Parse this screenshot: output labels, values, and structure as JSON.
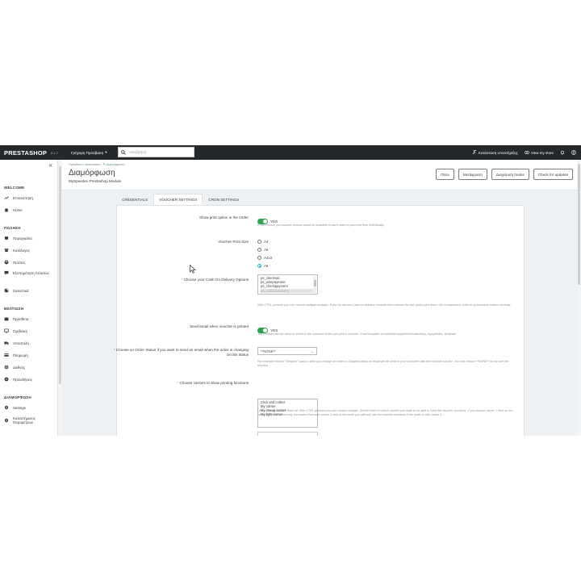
{
  "topbar": {
    "logo": "PRESTASHOP",
    "version": "8.1.7",
    "quick_access": "Γρήγορη Πρόσβαση",
    "search_placeholder": "Αναζήτηση",
    "maintenance": "Κατάσταση υποστήριξης",
    "view_store": "View my store"
  },
  "sidebar": {
    "sections": [
      {
        "title": "WELCOME",
        "items": [
          {
            "label": "Επισκόπηση",
            "icon": "trend-icon"
          },
          {
            "label": "Home",
            "icon": "home-icon"
          }
        ]
      },
      {
        "title": "ΠΩΛΗΣΗ",
        "items": [
          {
            "label": "Παραγγελίες",
            "icon": "cart-icon"
          },
          {
            "label": "Κατάλογος",
            "icon": "store-icon"
          },
          {
            "label": "Πελάτες",
            "icon": "user-icon"
          },
          {
            "label": "Εξυπηρέτηση πελατών",
            "icon": "chat-icon"
          },
          {
            "label": "Στατιστικά",
            "icon": "chart-icon"
          }
        ]
      },
      {
        "title": "ΒΕΛΤΙΩΣΗ",
        "items": [
          {
            "label": "Πρόσθετα",
            "icon": "puzzle-icon"
          },
          {
            "label": "Σχεδίαση",
            "icon": "desktop-icon"
          },
          {
            "label": "Αποστολή",
            "icon": "truck-icon"
          },
          {
            "label": "Πληρωμή",
            "icon": "card-icon"
          },
          {
            "label": "Διεθνής",
            "icon": "globe-icon"
          },
          {
            "label": "Προωθήσεις",
            "icon": "tag-icon"
          }
        ]
      },
      {
        "title": "ΔΙΑΜΟΡΦΩΣΗ",
        "items": [
          {
            "label": "Settings",
            "icon": "gear-icon"
          },
          {
            "label": "Καταστήματος Παραμέτρων",
            "icon": "gear-icon"
          }
        ]
      }
    ]
  },
  "header": {
    "breadcrumb": [
      "Πρόσθετα",
      "mymodules",
      "Διαμόρφωση"
    ],
    "title": "Διαμόρφωση",
    "subtitle": "MySpeedex Prestashop Module",
    "buttons": [
      "Πίσω",
      "Μετάφραση",
      "Διαχείριση hooks",
      "Check for updates"
    ]
  },
  "tabs": [
    "CREDENTIALS",
    "VOUCHER SETTINGS",
    "CRON SETTINGS"
  ],
  "active_tab": "VOUCHER SETTINGS",
  "form": {
    "show_print": {
      "label": "Show print option in the Order",
      "value": "YES",
      "help": "If you choose yes voucher actions would be available in each order to print one from individually."
    },
    "voucher_size": {
      "label": "Voucher Print Size",
      "options": [
        "A4",
        "A6",
        "A4x3",
        "A6"
      ],
      "selected": 3
    },
    "cod": {
      "label": "Choose your Cash On Delivery Options",
      "options": [
        "ps_checkout",
        "ps_wirepayment",
        "ps_checkpayment",
        "ps_cashondelivery"
      ],
      "help": "With CTRL pressed you can choose multiple modules. If you do not use Cash on delivery modules then choose the last option pick there, this is required in order to synchronize orders correctly."
    },
    "send_email": {
      "label": "Send email when voucher is printed",
      "value": "YES",
      "help": "The module will can send an email to the customer when you print a voucher. Email template at modules/myspeedex/mails/el/ps_myspeedex_template"
    },
    "order_status": {
      "label": "Choose an Order Status if you want to send an email when the order is changing on this status",
      "value": "**NONE**",
      "help": "For example choose \"Shipped\" status, when you change an order to Shipped status an email will be send to your customer with the voucher number. You can choose **NONE** to not use this function."
    },
    "carriers": {
      "label": "Choose carriers to show printing functions",
      "options": [
        "Click and collect",
        "My carrier",
        "My cheap carrier",
        "My light carrier"
      ],
      "help": "Leave it blank to have them all. With CTRL pressed you can choose multiple. Decide which in which carriers you want to be able to have the voucher functions. If you choose carrier 1 then on the orders list you will see only the orders that have carrier 1 sent to the order you will only see the voucher functions if the order is with carrier 1."
    }
  },
  "colors": {
    "topbar": "#25282b",
    "toggle": "#2ea44f",
    "accent": "#25b9d7"
  }
}
